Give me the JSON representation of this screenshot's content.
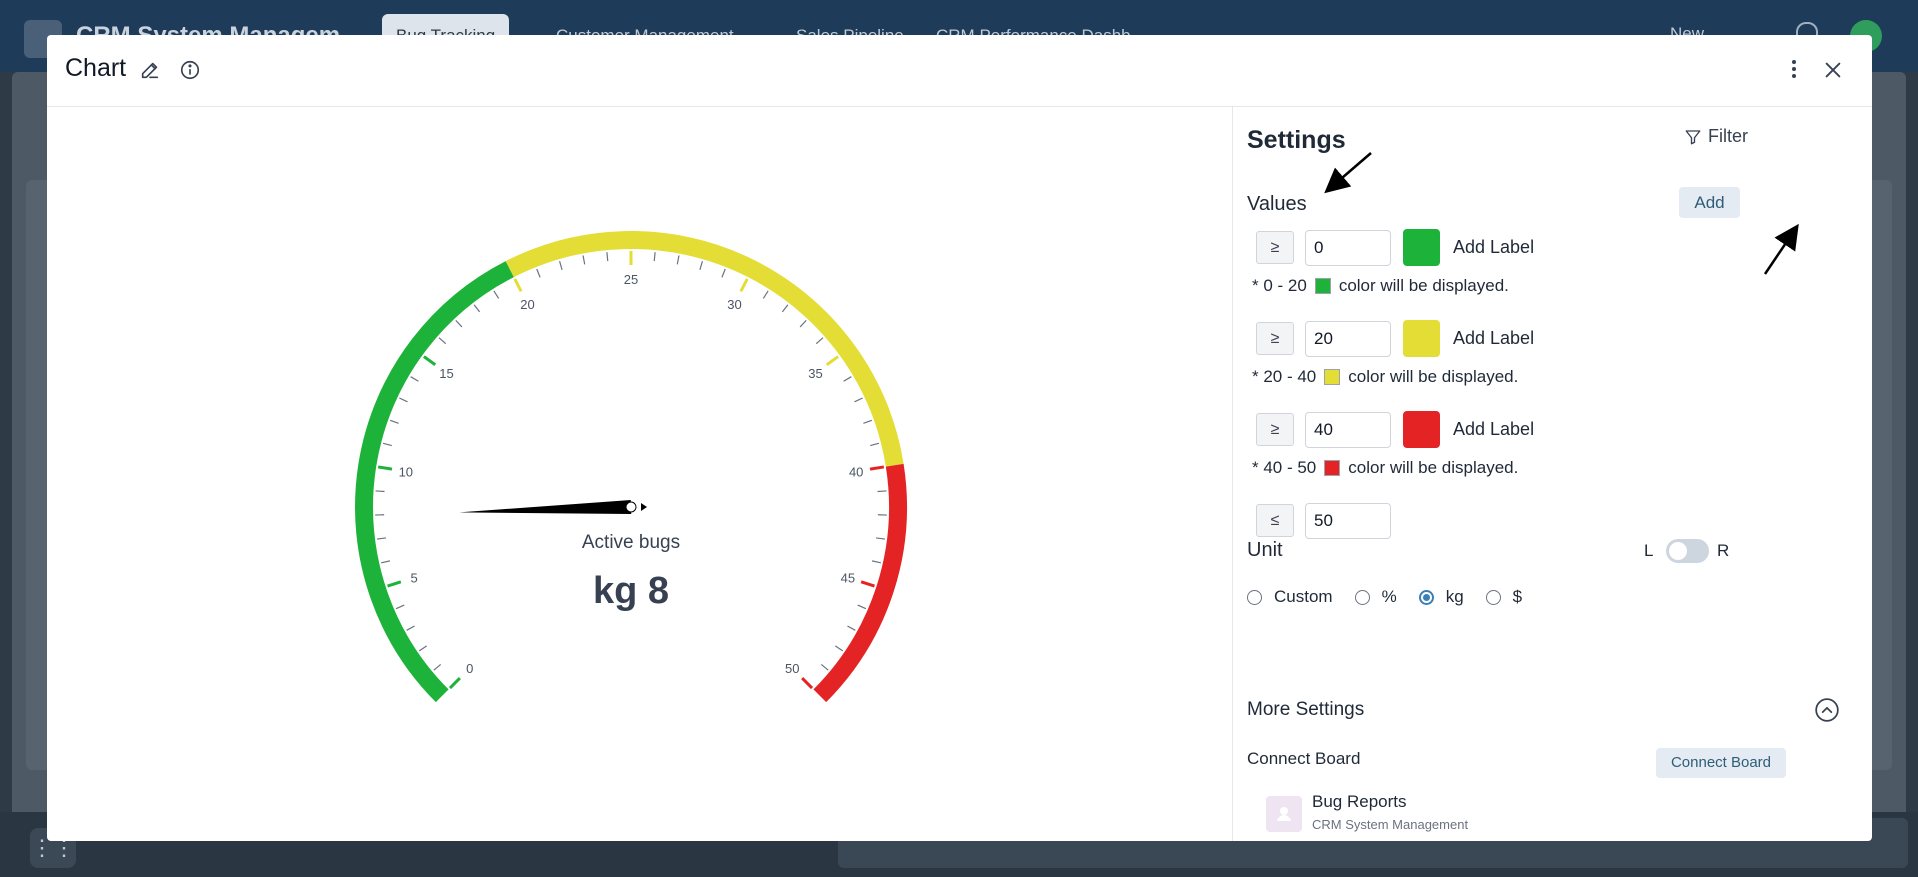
{
  "background": {
    "app_title": "CRM System Managem",
    "tabs": [
      "Bug Tracking",
      "Customer Management",
      "Sales Pipeline",
      "CRM Performance Dashb"
    ],
    "new_label": "New"
  },
  "modal": {
    "title": "Chart",
    "icons": {
      "edit": "edit-icon",
      "info": "info-icon",
      "more": "more-vertical-icon",
      "close": "close-icon"
    }
  },
  "gauge": {
    "label": "Active bugs",
    "value_text": "kg 8",
    "value": 8,
    "min": 0,
    "max": 50,
    "ticks": [
      "0",
      "5",
      "10",
      "15",
      "20",
      "25",
      "30",
      "35",
      "40",
      "45",
      "50"
    ],
    "bands": [
      {
        "from": 0,
        "to": 20,
        "color": "#1db33a"
      },
      {
        "from": 20,
        "to": 40,
        "color": "#e3dd35"
      },
      {
        "from": 40,
        "to": 50,
        "color": "#e42424"
      }
    ]
  },
  "settings": {
    "title": "Settings",
    "filter_label": "Filter",
    "values_label": "Values",
    "add_label": "Add",
    "thresholds": [
      {
        "op": "≥",
        "value": "0",
        "color": "#1db33a",
        "label": "Add Label",
        "note_range": "* 0 - 20",
        "note_suffix": "color will be displayed."
      },
      {
        "op": "≥",
        "value": "20",
        "color": "#e3dd35",
        "label": "Add Label",
        "note_range": "* 20 - 40",
        "note_suffix": "color will be displayed."
      },
      {
        "op": "≥",
        "value": "40",
        "color": "#e42424",
        "label": "Add Label",
        "note_range": "* 40 - 50",
        "note_suffix": "color will be displayed."
      }
    ],
    "max_threshold": {
      "op": "≤",
      "value": "50"
    },
    "unit_label": "Unit",
    "toggle_left": "L",
    "toggle_right": "R",
    "units": [
      {
        "label": "Custom",
        "checked": false
      },
      {
        "label": "%",
        "checked": false
      },
      {
        "label": "kg",
        "checked": true
      },
      {
        "label": "$",
        "checked": false
      }
    ],
    "more_settings_label": "More Settings",
    "connect_board_label": "Connect Board",
    "connect_board_button": "Connect Board",
    "board_name": "Bug Reports",
    "board_subtitle": "CRM System Management"
  }
}
